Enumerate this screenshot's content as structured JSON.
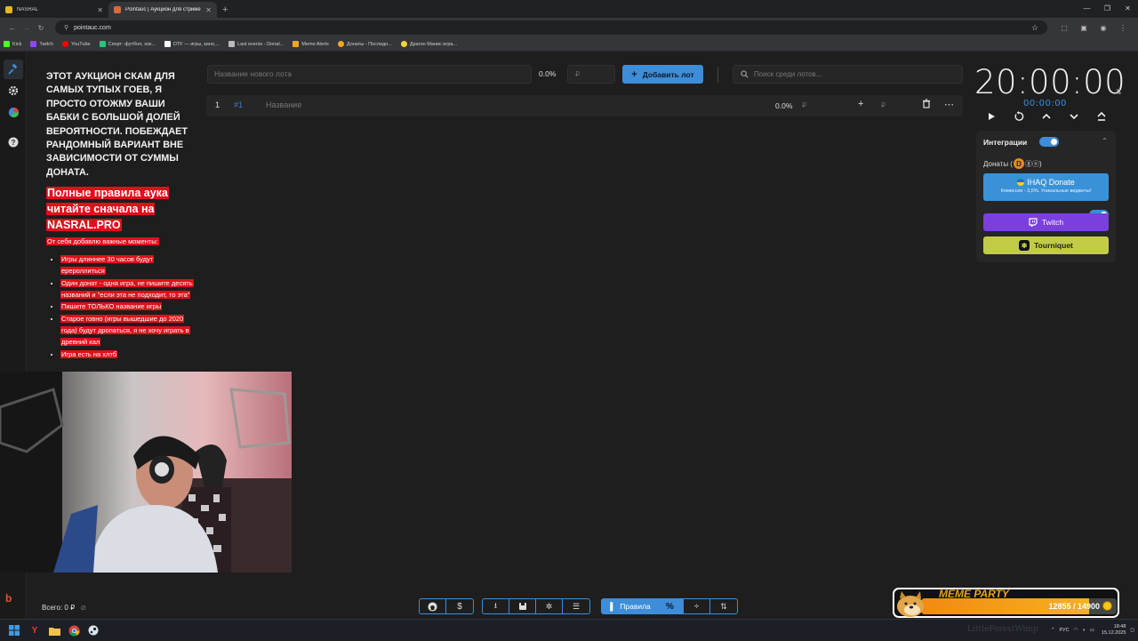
{
  "browser": {
    "tabs": [
      {
        "title": "NASRAL",
        "active": false,
        "color": "#e6b820"
      },
      {
        "title": "Pointauc | Аукцион для стриме",
        "active": true,
        "color": "#d96a3a"
      }
    ],
    "new_tab": "+",
    "window_controls": [
      "—",
      "❐",
      "✕"
    ],
    "url": "pointauc.com",
    "bookmarks": [
      {
        "label": "Kick",
        "color": "#53fc18"
      },
      {
        "label": "Twitch",
        "color": "#9146ff"
      },
      {
        "label": "YouTube",
        "color": "#ff0000"
      },
      {
        "label": "Спорт: футбол, хок...",
        "color": "#2ec27e"
      },
      {
        "label": "DTF — игры, кино,...",
        "color": "#ffffff"
      },
      {
        "label": "Last events - Donat...",
        "color": "#bbbbbb"
      },
      {
        "label": "Meme Alerts",
        "color": "#f5a623"
      },
      {
        "label": "Донаты - Последн...",
        "color": "#f5a623"
      },
      {
        "label": "Драгон Манис игра...",
        "color": "#f7d33c"
      }
    ]
  },
  "rules": {
    "intro": "ЭТОТ АУКЦИОН СКАМ ДЛЯ САМЫХ ТУПЫХ ГОЕВ, Я ПРОСТО ОТОЖМУ ВАШИ БАБКИ С БОЛЬШОЙ ДОЛЕЙ ВЕРОЯТНОСТИ. ПОБЕЖДАЕТ РАНДОМНЫЙ ВАРИАНТ ВНЕ ЗАВИСИМОСТИ ОТ СУММЫ ДОНАТА.",
    "headline": "Полные правила аука читайте сначала на NASRAL.PRO",
    "subhead": "От себя добавлю важные моменты:",
    "items": [
      "Игры длиннее 30 часов будут ерероллиться",
      "Один донат - одна игра, не пишите десять названий и \"если эта не подходит, то эта\"",
      "Пишите ТОЛЬКО название игры",
      "Старое говно (игры вышедшие до 2020 года) будут дропаться, я не хочу играть в древний кал",
      "Игра есть на хлтб"
    ]
  },
  "lot_form": {
    "name_placeholder": "Название нового лота",
    "percent": "0.0%",
    "amount_placeholder": "₽",
    "add_button": "Добавить лот",
    "search_placeholder": "Поиск среди лотов..."
  },
  "lots": [
    {
      "num": "1",
      "fast": "#1",
      "name_placeholder": "Название",
      "percent": "0.0%",
      "amount_placeholder": "₽"
    }
  ],
  "timer": {
    "main": "20:00:00",
    "sub": "00:00:00"
  },
  "integrations": {
    "title": "Интеграции",
    "enabled": true,
    "donations_label": "Донаты (",
    "donations_suffix": "ⓖⓞ)",
    "donations_enabled": true,
    "ihaq_title": "IHAQ Donate",
    "ihaq_sub": "Комиссия - 3,5%. Уникальные виджеты!",
    "twitch": "Twitch",
    "tourniquet": "Tourniquet"
  },
  "footer": {
    "total": "Всего: 0 ₽",
    "rules_button": "Правила"
  },
  "meme_party": {
    "title": "MEME PARTY",
    "progress": "12855 / 14900",
    "current": 12855,
    "goal": 14900
  },
  "taskbar": {
    "lang": "РУС",
    "time": "18:48",
    "date": "15.12.2025",
    "watermark": "LittleForestWimp"
  },
  "colors": {
    "accent": "#3d8dd9",
    "highlight": "#e0101a",
    "twitch": "#7b3fe0",
    "tourniquet": "#c2cb47"
  }
}
